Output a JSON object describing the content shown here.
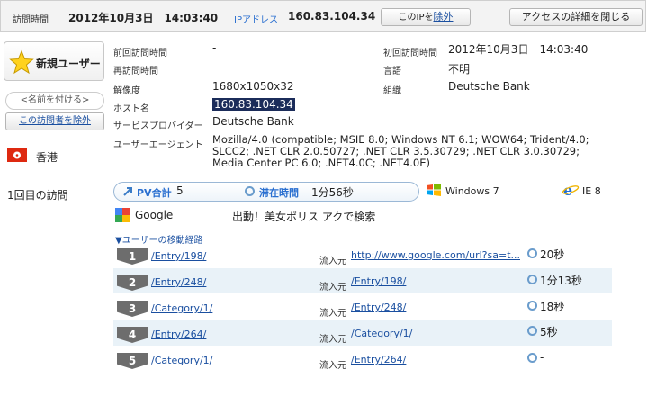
{
  "header": {
    "visit_time_label": "訪問時間",
    "visit_time_value": "2012年10月3日　14:03:40",
    "ip_label": "IPアドレス",
    "ip_value": "160.83.104.34",
    "exclude_ip_prefix": "このIPを",
    "exclude_ip_link": "除外",
    "close_details_button": "アクセスの詳細を閉じる"
  },
  "left": {
    "new_user_label": "新規ユーザー",
    "name_tag_label": "<名前を付ける>",
    "exclude_visitor_button": "この訪問者を除外",
    "country_label": "香港",
    "visit_count_label": "1回目の訪問"
  },
  "details": {
    "prev_visit_label": "前回訪問時間",
    "prev_visit_value": "-",
    "revisit_label": "再訪問時間",
    "revisit_value": "-",
    "resolution_label": "解像度",
    "resolution_value": "1680x1050x32",
    "host_label": "ホスト名",
    "host_value": "160.83.104.34",
    "provider_label": "サービスプロバイダー",
    "provider_value": "Deutsche Bank",
    "ua_label": "ユーザーエージェント",
    "ua_value": "Mozilla/4.0 (compatible; MSIE 8.0; Windows NT 6.1; WOW64; Trident/4.0; SLCC2; .NET CLR 2.0.50727; .NET CLR 3.5.30729; .NET CLR 3.0.30729; Media Center PC 6.0; .NET4.0C; .NET4.0E)",
    "first_visit_label": "初回訪問時間",
    "first_visit_value": "2012年10月3日　14:03:40",
    "language_label": "言語",
    "language_value": "不明",
    "org_label": "組織",
    "org_value": "Deutsche Bank"
  },
  "summary": {
    "pv_label": "PV合計",
    "pv_value": "5",
    "stay_label": "滞在時間",
    "stay_value": "1分56秒",
    "os_label": "Windows 7",
    "browser_label": "IE 8"
  },
  "search": {
    "engine": "Google",
    "query_text": "出動！美女ポリス アクで検索"
  },
  "path": {
    "header": "▼ユーザーの移動経路",
    "source_label": "流入元",
    "rows": [
      {
        "num": "1",
        "page": "/Entry/198/",
        "source": "http://www.google.com/url?sa=t...",
        "time": "20秒"
      },
      {
        "num": "2",
        "page": "/Entry/248/",
        "source": "/Entry/198/",
        "time": "1分13秒"
      },
      {
        "num": "3",
        "page": "/Category/1/",
        "source": "/Entry/248/",
        "time": "18秒"
      },
      {
        "num": "4",
        "page": "/Entry/264/",
        "source": "/Category/1/",
        "time": "5秒"
      },
      {
        "num": "5",
        "page": "/Category/1/",
        "source": "/Entry/264/",
        "time": "-"
      }
    ]
  },
  "colors": {
    "link": "#1a4fa0",
    "stripe": "#e9f2f8",
    "hex_flag": "#de2910"
  }
}
